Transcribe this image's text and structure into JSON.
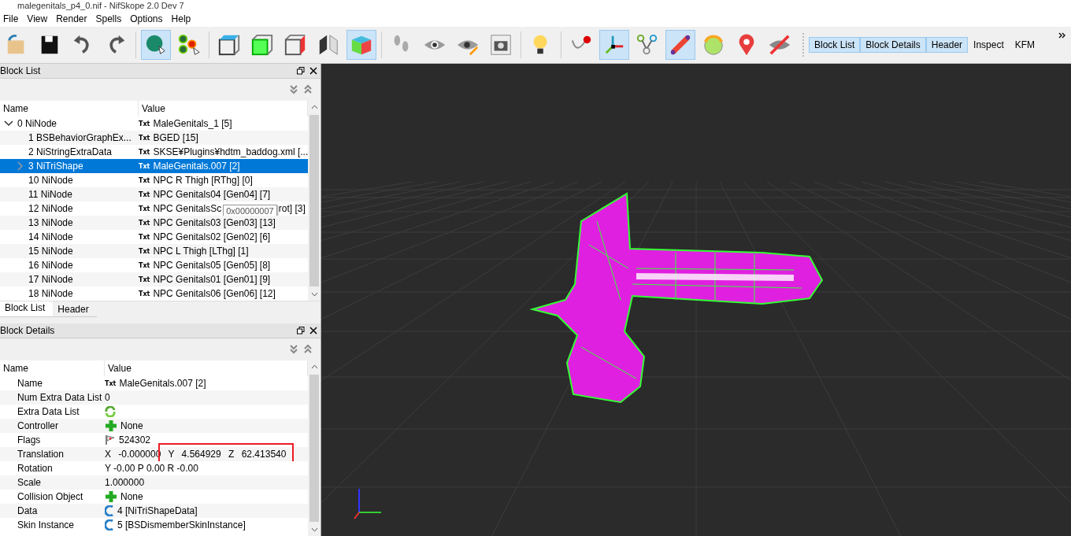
{
  "window": {
    "title": "malegenitals_p4_0.nif - NifSkope 2.0 Dev 7"
  },
  "menu": [
    "File",
    "View",
    "Render",
    "Spells",
    "Options",
    "Help"
  ],
  "toolbar": [
    [
      {
        "kind": "open",
        "selected": false
      },
      {
        "kind": "save",
        "selected": false
      },
      {
        "kind": "undo",
        "selected": false
      },
      {
        "kind": "redo",
        "selected": false
      }
    ],
    [
      {
        "kind": "select-object",
        "selected": true
      },
      {
        "kind": "select-vertex",
        "selected": false
      }
    ],
    [
      {
        "kind": "cube-top",
        "selected": false
      },
      {
        "kind": "cube-front",
        "selected": false
      },
      {
        "kind": "cube-side",
        "selected": false
      },
      {
        "kind": "flip",
        "selected": false
      },
      {
        "kind": "cube-color",
        "selected": true
      }
    ],
    [
      {
        "kind": "footprints",
        "selected": false
      },
      {
        "kind": "eye",
        "selected": false
      },
      {
        "kind": "eye-edit",
        "selected": false
      },
      {
        "kind": "camera",
        "selected": false
      }
    ],
    [
      {
        "kind": "bulb",
        "selected": false
      }
    ],
    [
      {
        "kind": "curve",
        "selected": false
      },
      {
        "kind": "axes",
        "selected": true
      },
      {
        "kind": "nodes",
        "selected": false
      },
      {
        "kind": "bone",
        "selected": true
      },
      {
        "kind": "gauge",
        "selected": false
      },
      {
        "kind": "pin",
        "selected": false
      },
      {
        "kind": "hidden",
        "selected": false
      }
    ]
  ],
  "dock_tabs": [
    {
      "label": "Block List",
      "selected": true
    },
    {
      "label": "Block Details",
      "selected": true
    },
    {
      "label": "Header",
      "selected": true
    },
    {
      "label": "Inspect",
      "selected": false
    },
    {
      "label": "KFM",
      "selected": false
    }
  ],
  "block_list": {
    "title": "Block List",
    "columns": [
      "Name",
      "Value"
    ],
    "tree": [
      {
        "name": "0 NiNode",
        "tag": "Txt",
        "value": "MaleGenitals_1 [5]",
        "expanded": true,
        "selected": false,
        "children": [
          {
            "name": "1 BSBehaviorGraphEx...",
            "tag": "Txt",
            "value": "BGED [15]",
            "selected": false
          },
          {
            "name": "2 NiStringExtraData",
            "tag": "Txt",
            "value": "SKSE¥Plugins¥hdtm_baddog.xml [...",
            "selected": false
          },
          {
            "name": "3 NiTriShape",
            "tag": "Txt",
            "value": "MaleGenitals.007 [2]",
            "expanded": false,
            "selected": true
          },
          {
            "name": "10 NiNode",
            "tag": "Txt",
            "value": "NPC R Thigh [RThg] [0]",
            "selected": false
          },
          {
            "name": "11 NiNode",
            "tag": "Txt",
            "value": "NPC Genitals04 [Gen04] [7]",
            "selected": false
          },
          {
            "name": "12 NiNode",
            "tag": "Txt",
            "value": "NPC GenitalsSc",
            "value_tail": "rot] [3]",
            "tooltip": "0x00000007",
            "selected": false
          },
          {
            "name": "13 NiNode",
            "tag": "Txt",
            "value": "NPC Genitals03 [Gen03] [13]",
            "selected": false
          },
          {
            "name": "14 NiNode",
            "tag": "Txt",
            "value": "NPC Genitals02 [Gen02] [6]",
            "selected": false
          },
          {
            "name": "15 NiNode",
            "tag": "Txt",
            "value": "NPC L Thigh [LThg] [1]",
            "selected": false
          },
          {
            "name": "16 NiNode",
            "tag": "Txt",
            "value": "NPC Genitals05 [Gen05] [8]",
            "selected": false
          },
          {
            "name": "17 NiNode",
            "tag": "Txt",
            "value": "NPC Genitals01 [Gen01] [9]",
            "selected": false
          },
          {
            "name": "18 NiNode",
            "tag": "Txt",
            "value": "NPC Genitals06 [Gen06] [12]",
            "selected": false
          }
        ]
      }
    ],
    "tabs": [
      {
        "label": "Block List",
        "selected": true
      },
      {
        "label": "Header",
        "selected": false
      }
    ]
  },
  "block_details": {
    "title": "Block Details",
    "columns": [
      "Name",
      "Value"
    ],
    "rows": [
      {
        "name": "Name",
        "kind": "text",
        "tag": "Txt",
        "value": "MaleGenitals.007 [2]"
      },
      {
        "name": "Num Extra Data List",
        "kind": "plain",
        "value": "0"
      },
      {
        "name": "Extra Data List",
        "kind": "array"
      },
      {
        "name": "Controller",
        "kind": "empty-ref",
        "value": "None"
      },
      {
        "name": "Flags",
        "kind": "flags",
        "value": "524302"
      },
      {
        "name": "Translation",
        "kind": "plain",
        "value": "X -0.000000 Y 4.564929 Z 62.413540",
        "highlighted": true
      },
      {
        "name": "Rotation",
        "kind": "plain",
        "value": "Y -0.00 P 0.00 R -0.00"
      },
      {
        "name": "Scale",
        "kind": "plain",
        "value": "1.000000"
      },
      {
        "name": "Collision Object",
        "kind": "empty-ref",
        "value": "None"
      },
      {
        "name": "Data",
        "kind": "ref",
        "value": "4 [NiTriShapeData]"
      },
      {
        "name": "Skin Instance",
        "kind": "ref",
        "value": "5 [BSDismemberSkinInstance]"
      }
    ]
  }
}
